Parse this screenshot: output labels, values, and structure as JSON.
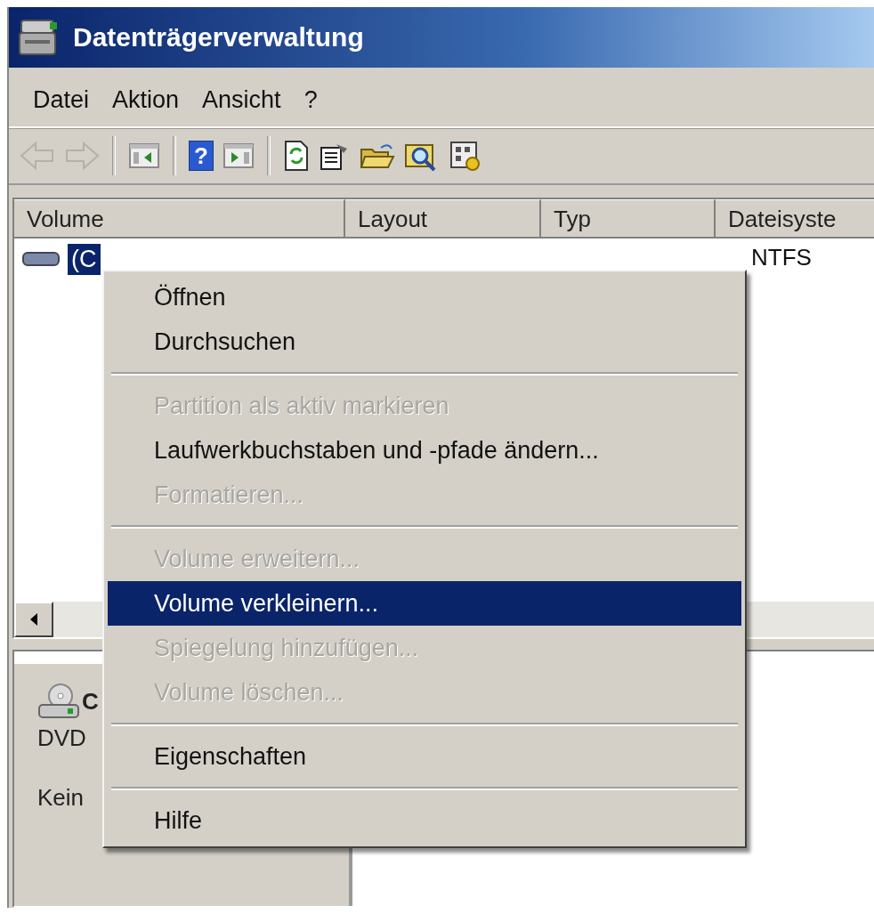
{
  "window": {
    "title": "Datenträgerverwaltung"
  },
  "menu_bar": [
    {
      "label": "Datei"
    },
    {
      "label": "Aktion"
    },
    {
      "label": "Ansicht"
    },
    {
      "label": "?"
    }
  ],
  "toolbar": [
    {
      "kind": "back",
      "disabled": true
    },
    {
      "kind": "forward",
      "disabled": true
    },
    {
      "kind": "separator"
    },
    {
      "kind": "pane-left",
      "disabled": false
    },
    {
      "kind": "separator"
    },
    {
      "kind": "help",
      "label": "?",
      "disabled": false
    },
    {
      "kind": "pane-right",
      "disabled": false
    },
    {
      "kind": "separator"
    },
    {
      "kind": "refresh",
      "disabled": false
    },
    {
      "kind": "properties",
      "disabled": false
    },
    {
      "kind": "open",
      "disabled": false
    },
    {
      "kind": "search",
      "disabled": false
    },
    {
      "kind": "settings",
      "disabled": false
    }
  ],
  "volume_table": {
    "columns": [
      "Volume",
      "Layout",
      "Typ",
      "Dateisyste"
    ],
    "rows": [
      {
        "volume": "(C",
        "file_system": "NTFS",
        "selected": true
      }
    ]
  },
  "disk_pane": {
    "disk_label": "C",
    "disk_type": "DVD",
    "status": "Kein"
  },
  "context_menu": [
    {
      "kind": "item",
      "label": "Öffnen",
      "disabled": false,
      "selected": false
    },
    {
      "kind": "item",
      "label": "Durchsuchen",
      "disabled": false,
      "selected": false
    },
    {
      "kind": "separator"
    },
    {
      "kind": "item",
      "label": "Partition als aktiv markieren",
      "disabled": true,
      "selected": false
    },
    {
      "kind": "item",
      "label": "Laufwerkbuchstaben und -pfade ändern...",
      "disabled": false,
      "selected": false
    },
    {
      "kind": "item",
      "label": "Formatieren...",
      "disabled": true,
      "selected": false
    },
    {
      "kind": "separator"
    },
    {
      "kind": "item",
      "label": "Volume erweitern...",
      "disabled": true,
      "selected": false
    },
    {
      "kind": "item",
      "label": "Volume verkleinern...",
      "disabled": false,
      "selected": true
    },
    {
      "kind": "item",
      "label": "Spiegelung hinzufügen...",
      "disabled": true,
      "selected": false
    },
    {
      "kind": "item",
      "label": "Volume löschen...",
      "disabled": true,
      "selected": false
    },
    {
      "kind": "separator"
    },
    {
      "kind": "item",
      "label": "Eigenschaften",
      "disabled": false,
      "selected": false
    },
    {
      "kind": "separator"
    },
    {
      "kind": "item",
      "label": "Hilfe",
      "disabled": false,
      "selected": false
    }
  ]
}
